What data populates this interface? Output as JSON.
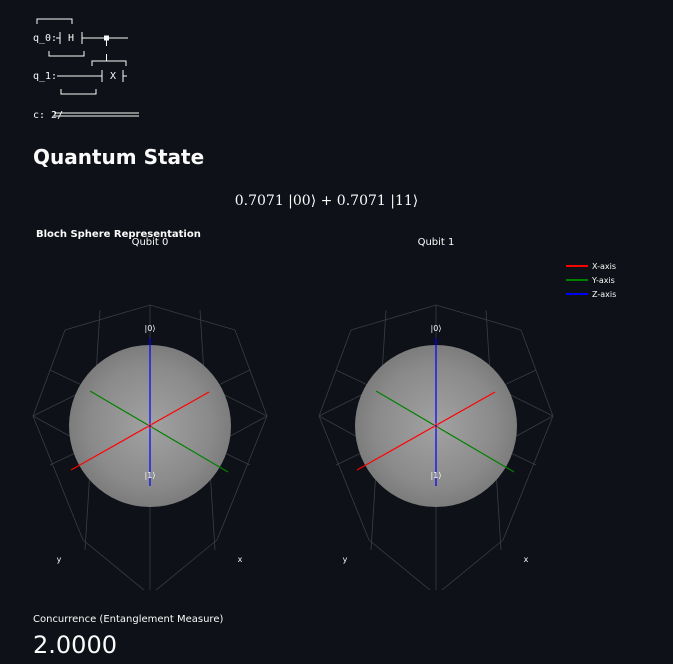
{
  "circuit": {
    "q0_label": "q_0:",
    "q1_label": "q_1:",
    "c_label": "c: 2/",
    "h_gate": "H",
    "x_gate": "X"
  },
  "state_heading": "Quantum State",
  "state_expression": "0.7071 |00⟩ + 0.7071 |11⟩",
  "bloch": {
    "title": "Bloch Sphere Representation",
    "qubits": [
      {
        "title": "Qubit 0",
        "ket0": "|0⟩",
        "ket1": "|1⟩",
        "x_axis": "x",
        "y_axis": "y"
      },
      {
        "title": "Qubit 1",
        "ket0": "|0⟩",
        "ket1": "|1⟩",
        "x_axis": "x",
        "y_axis": "y"
      }
    ],
    "legend": [
      {
        "label": "X-axis",
        "color": "#ff0000"
      },
      {
        "label": "Y-axis",
        "color": "#008000"
      },
      {
        "label": "Z-axis",
        "color": "#0000ff"
      }
    ]
  },
  "metric": {
    "label": "Concurrence (Entanglement Measure)",
    "value": "2.0000"
  }
}
